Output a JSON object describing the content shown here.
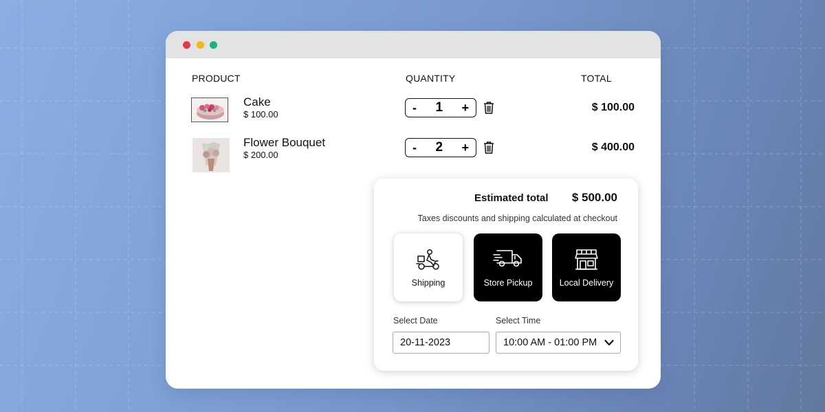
{
  "headers": {
    "product": "PRODUCT",
    "quantity": "QUANTITY",
    "total": "TOTAL"
  },
  "items": [
    {
      "name": "Cake",
      "price": "$ 100.00",
      "quantity": "1",
      "total": "$ 100.00"
    },
    {
      "name": "Flower Bouquet",
      "price": "$ 200.00",
      "quantity": "2",
      "total": "$ 400.00"
    }
  ],
  "stepper": {
    "minus": "-",
    "plus": "+"
  },
  "summary": {
    "estimated_label": "Estimated total",
    "estimated_value": "$ 500.00",
    "taxes_note": "Taxes discounts and shipping calculated at checkout"
  },
  "options": [
    {
      "label": "Shipping",
      "icon": "scooter-delivery-icon",
      "selected": true
    },
    {
      "label": "Store Pickup",
      "icon": "delivery-truck-icon",
      "selected": false
    },
    {
      "label": "Local Delivery",
      "icon": "storefront-icon",
      "selected": false
    }
  ],
  "date": {
    "label": "Select Date",
    "value": "20-11-2023"
  },
  "time": {
    "label": "Select Time",
    "value": "10:00 AM - 01:00 PM"
  },
  "colors": {
    "background": "#7b9bcf",
    "dark_button": "#000000",
    "dot_red": "#e8364a",
    "dot_yellow": "#f2b71c",
    "dot_green": "#1eb27a"
  }
}
